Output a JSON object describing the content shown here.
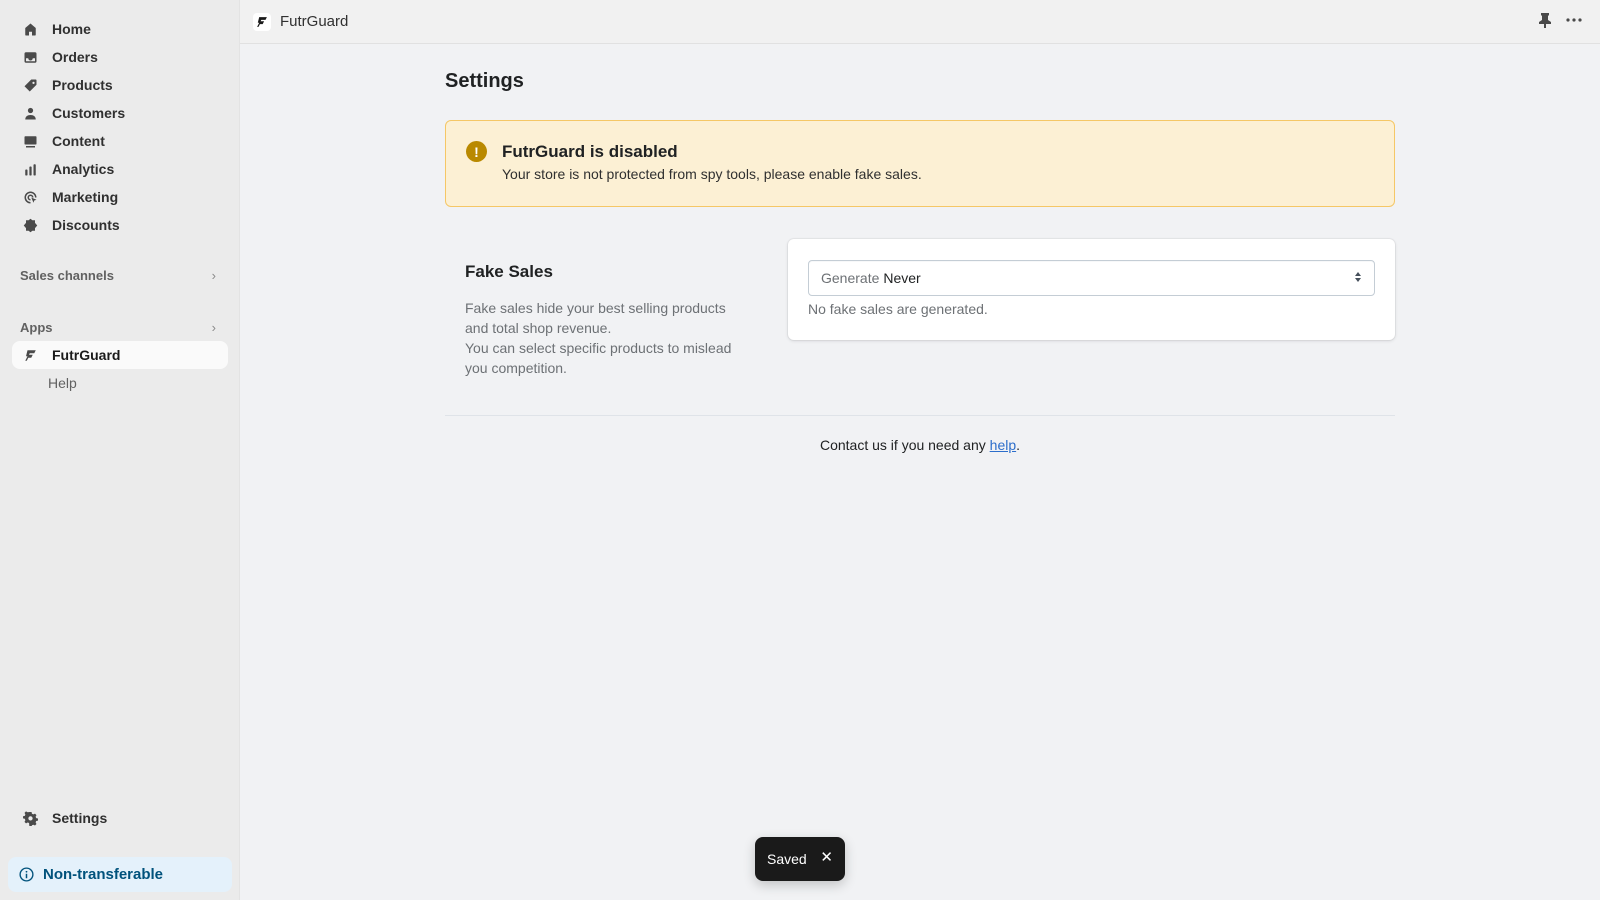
{
  "sidebar": {
    "items": [
      {
        "label": "Home",
        "icon": "home-icon"
      },
      {
        "label": "Orders",
        "icon": "inbox-icon"
      },
      {
        "label": "Products",
        "icon": "tag-icon"
      },
      {
        "label": "Customers",
        "icon": "person-icon"
      },
      {
        "label": "Content",
        "icon": "image-icon"
      },
      {
        "label": "Analytics",
        "icon": "bar-chart-icon"
      },
      {
        "label": "Marketing",
        "icon": "target-icon"
      },
      {
        "label": "Discounts",
        "icon": "discount-icon"
      }
    ],
    "sales_channels_label": "Sales channels",
    "apps_label": "Apps",
    "apps": [
      {
        "label": "FutrGuard",
        "active": true
      },
      {
        "label": "Help"
      }
    ],
    "settings_label": "Settings",
    "plan_badge": "Non-transferable"
  },
  "topbar": {
    "app_name": "FutrGuard"
  },
  "main": {
    "page_title": "Settings",
    "banner": {
      "title": "FutrGuard is disabled",
      "body": "Your store is not protected from spy tools, please enable fake sales.",
      "color": "#fcf0d4"
    },
    "fake_sales": {
      "title": "Fake Sales",
      "desc_line1": "Fake sales hide your best selling products and total shop revenue.",
      "desc_line2": "You can select specific products to mislead you competition.",
      "select_label": "Generate",
      "select_value": "Never",
      "help_text": "No fake sales are generated."
    },
    "footer": {
      "text": "Contact us if you need any ",
      "link": "help",
      "suffix": "."
    }
  },
  "toast": {
    "message": "Saved",
    "close": "✕"
  }
}
